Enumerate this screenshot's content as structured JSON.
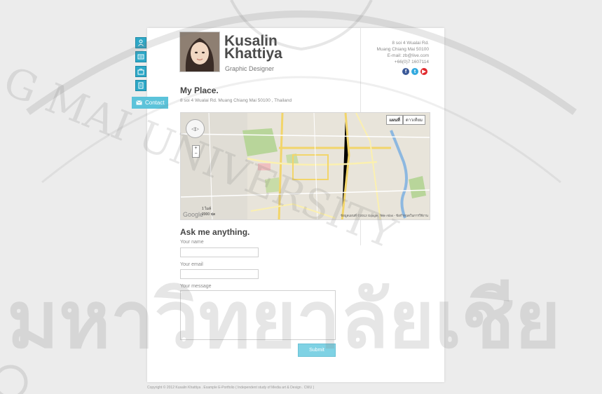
{
  "nav": {
    "icons": [
      "user-icon",
      "inbox-icon",
      "briefcase-icon",
      "document-icon"
    ],
    "contact_label": "Contact"
  },
  "header": {
    "first_name": "Kusalin",
    "last_name": "Khattiya",
    "title": "Graphic Designer",
    "address_line": "8 soi 4 Wualai Rd.",
    "city_line": "Muang Chiang Mai 50100",
    "email_line": "E-mail: zb@live.com",
    "phone_line": "+66(0)7 1607114",
    "social": [
      "facebook-icon",
      "twitter-icon",
      "youtube-icon"
    ]
  },
  "place": {
    "heading": "My Place.",
    "address": "8 soi 4 Wualai Rd. Muang Chiang Mai 50100 , Thailand"
  },
  "map": {
    "type_map": "แผนที่",
    "type_satellite": "ดาวเทียม",
    "google": "Google",
    "scale_top": "1 ไมล์",
    "scale_bottom": "2000 ฟุต",
    "attribution": "ข้อมูลแผนที่ ©2012 Google, Tele Atlas - ข้อกำหนดในการใช้งาน"
  },
  "form": {
    "heading": "Ask me anything.",
    "name_label": "Your name",
    "email_label": "Your email",
    "message_label": "Your message",
    "submit_label": "Submit"
  },
  "footer": {
    "text": "Copyright © 2012 Kusalin Khattiya . Example E-Portfolio ( Independent study of Media art & Design . CMU )"
  },
  "watermark": {
    "thai_text": "มหาวิทยาลัยเชีย",
    "arc_text": "G MAI UNIVERSITY"
  },
  "colors": {
    "accent": "#2ea8c7",
    "submit": "#7fd2e4",
    "facebook": "#3b5998",
    "twitter": "#33aadf",
    "youtube": "#e0282c"
  }
}
